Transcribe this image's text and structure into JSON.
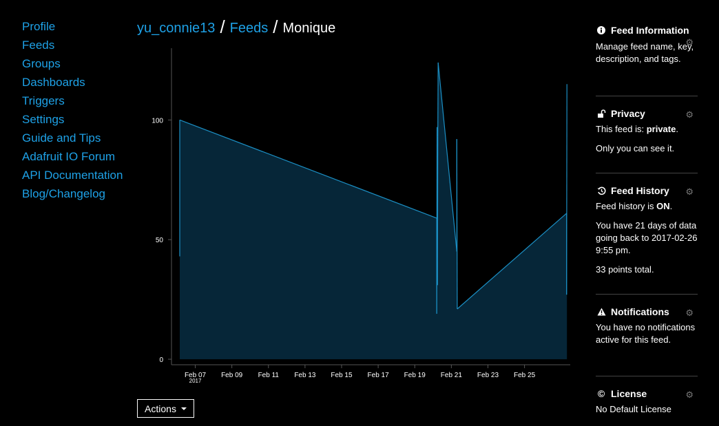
{
  "nav": {
    "items": [
      {
        "label": "Profile",
        "name": "nav-profile"
      },
      {
        "label": "Feeds",
        "name": "nav-feeds"
      },
      {
        "label": "Groups",
        "name": "nav-groups"
      },
      {
        "label": "Dashboards",
        "name": "nav-dashboards"
      },
      {
        "label": "Triggers",
        "name": "nav-triggers"
      },
      {
        "label": "Settings",
        "name": "nav-settings"
      },
      {
        "label": "Guide and Tips",
        "name": "nav-guide-and-tips"
      },
      {
        "label": "Adafruit IO Forum",
        "name": "nav-adafruit-io-forum"
      },
      {
        "label": "API Documentation",
        "name": "nav-api-documentation"
      },
      {
        "label": "Blog/Changelog",
        "name": "nav-blog-changelog"
      }
    ]
  },
  "breadcrumb": {
    "user": "yu_connie13",
    "feeds": "Feeds",
    "current": "Monique",
    "separator": "/"
  },
  "actions": {
    "label": "Actions"
  },
  "chart_data": {
    "type": "area",
    "x_ticks": [
      "Feb 07",
      "Feb 09",
      "Feb 11",
      "Feb 13",
      "Feb 15",
      "Feb 17",
      "Feb 19",
      "Feb 21",
      "Feb 23",
      "Feb 25"
    ],
    "x_year_label": "2017",
    "y_ticks": [
      0,
      50,
      100
    ],
    "ylim": [
      0,
      130
    ],
    "xlim_days": [
      5.7,
      27.5
    ],
    "points": [
      {
        "x": 6.15,
        "y": 43
      },
      {
        "x": 6.15,
        "y": 100
      },
      {
        "x": 20.2,
        "y": 59
      },
      {
        "x": 20.2,
        "y": 19
      },
      {
        "x": 20.22,
        "y": 97
      },
      {
        "x": 20.24,
        "y": 31
      },
      {
        "x": 20.26,
        "y": 93
      },
      {
        "x": 20.28,
        "y": 124
      },
      {
        "x": 21.3,
        "y": 45
      },
      {
        "x": 21.3,
        "y": 92
      },
      {
        "x": 21.32,
        "y": 21
      },
      {
        "x": 27.3,
        "y": 61
      },
      {
        "x": 27.3,
        "y": 27
      },
      {
        "x": 27.32,
        "y": 115
      }
    ],
    "line_color": "#1b8fc4",
    "fill_color": "#062638",
    "grid": false
  },
  "panel": {
    "info": {
      "title": "Feed Information",
      "text": "Manage feed name, key, description, and tags."
    },
    "privacy": {
      "title": "Privacy",
      "prefix": "This feed is: ",
      "value": "private",
      "suffix": ".",
      "text2": "Only you can see it."
    },
    "history": {
      "title": "Feed History",
      "prefix": "Feed history is ",
      "value": "ON",
      "suffix": ".",
      "text2": "You have 21 days of data going back to 2017-02-26 9:55 pm.",
      "text3": "33 points total."
    },
    "notifications": {
      "title": "Notifications",
      "text": "You have no notifications active for this feed."
    },
    "license": {
      "title": "License",
      "text": "No Default License"
    }
  },
  "icons": {
    "info": "info-circle-icon",
    "privacy": "unlock-icon",
    "history": "history-icon",
    "notifications": "warning-icon",
    "license": "copyright-icon",
    "settings": "gear-icon",
    "caret": "caret-down-icon"
  }
}
